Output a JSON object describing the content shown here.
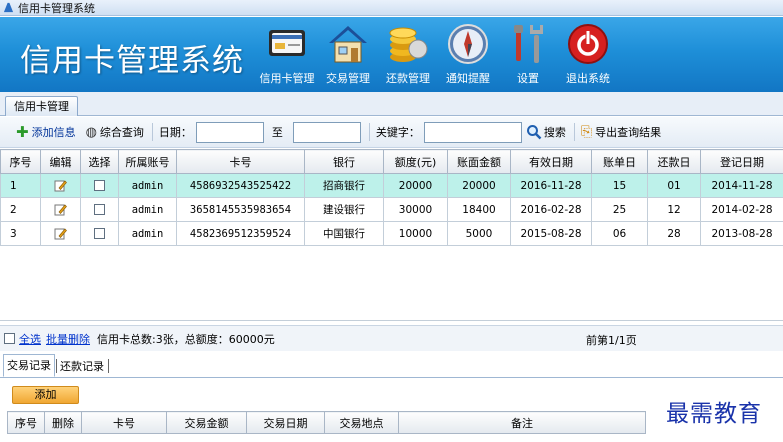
{
  "window": {
    "title": "信用卡管理系统"
  },
  "header": {
    "app_title": "信用卡管理系统",
    "nav": [
      {
        "label": "信用卡管理",
        "icon": "credit-card-icon"
      },
      {
        "label": "交易管理",
        "icon": "house-icon"
      },
      {
        "label": "还款管理",
        "icon": "coins-icon"
      },
      {
        "label": "通知提醒",
        "icon": "compass-icon"
      },
      {
        "label": "设置",
        "icon": "tools-icon"
      },
      {
        "label": "退出系统",
        "icon": "power-icon"
      }
    ]
  },
  "main_tab": {
    "label": "信用卡管理"
  },
  "toolbar": {
    "add_label": "添加信息",
    "query_label": "综合查询",
    "date_label": "日期：",
    "date_from": "",
    "to_label": "至",
    "date_to": "",
    "keyword_label": "关键字：",
    "keyword": "",
    "search_label": "搜索",
    "export_label": "导出查询结果"
  },
  "grid": {
    "columns": [
      "序号",
      "编辑",
      "选择",
      "所属账号",
      "卡号",
      "银行",
      "额度(元)",
      "账面金额",
      "有效日期",
      "账单日",
      "还款日",
      "登记日期"
    ],
    "rows": [
      {
        "no": "1",
        "account": "admin",
        "card_no": "4586932543525422",
        "bank": "招商银行",
        "limit": "20000",
        "balance": "20000",
        "expiry": "2016-11-28",
        "bill_day": "15",
        "repay_day": "01",
        "reg_date": "2014-11-28",
        "selected": true
      },
      {
        "no": "2",
        "account": "admin",
        "card_no": "3658145535983654",
        "bank": "建设银行",
        "limit": "30000",
        "balance": "18400",
        "expiry": "2016-02-28",
        "bill_day": "25",
        "repay_day": "12",
        "reg_date": "2014-02-28",
        "selected": false
      },
      {
        "no": "3",
        "account": "admin",
        "card_no": "4582369512359524",
        "bank": "中国银行",
        "limit": "10000",
        "balance": "5000",
        "expiry": "2015-08-28",
        "bill_day": "06",
        "repay_day": "28",
        "reg_date": "2013-08-28",
        "selected": false
      }
    ]
  },
  "footer": {
    "select_all": "全选",
    "batch_delete": "批量删除",
    "summary": "信用卡总数:3张，总额度：60000元",
    "pager": "前第1/1页"
  },
  "subtabs": [
    "交易记录",
    "还款记录"
  ],
  "sub_add_label": "添加",
  "subgrid": {
    "columns": [
      "序号",
      "删除",
      "卡号",
      "交易金额",
      "交易日期",
      "交易地点",
      "备注"
    ]
  },
  "watermark": "最需教育",
  "colors": {
    "header_blue": "#1e8fd8",
    "selected_row": "#bdf1ea",
    "add_button": "#f0a733",
    "link": "#0033cc"
  }
}
